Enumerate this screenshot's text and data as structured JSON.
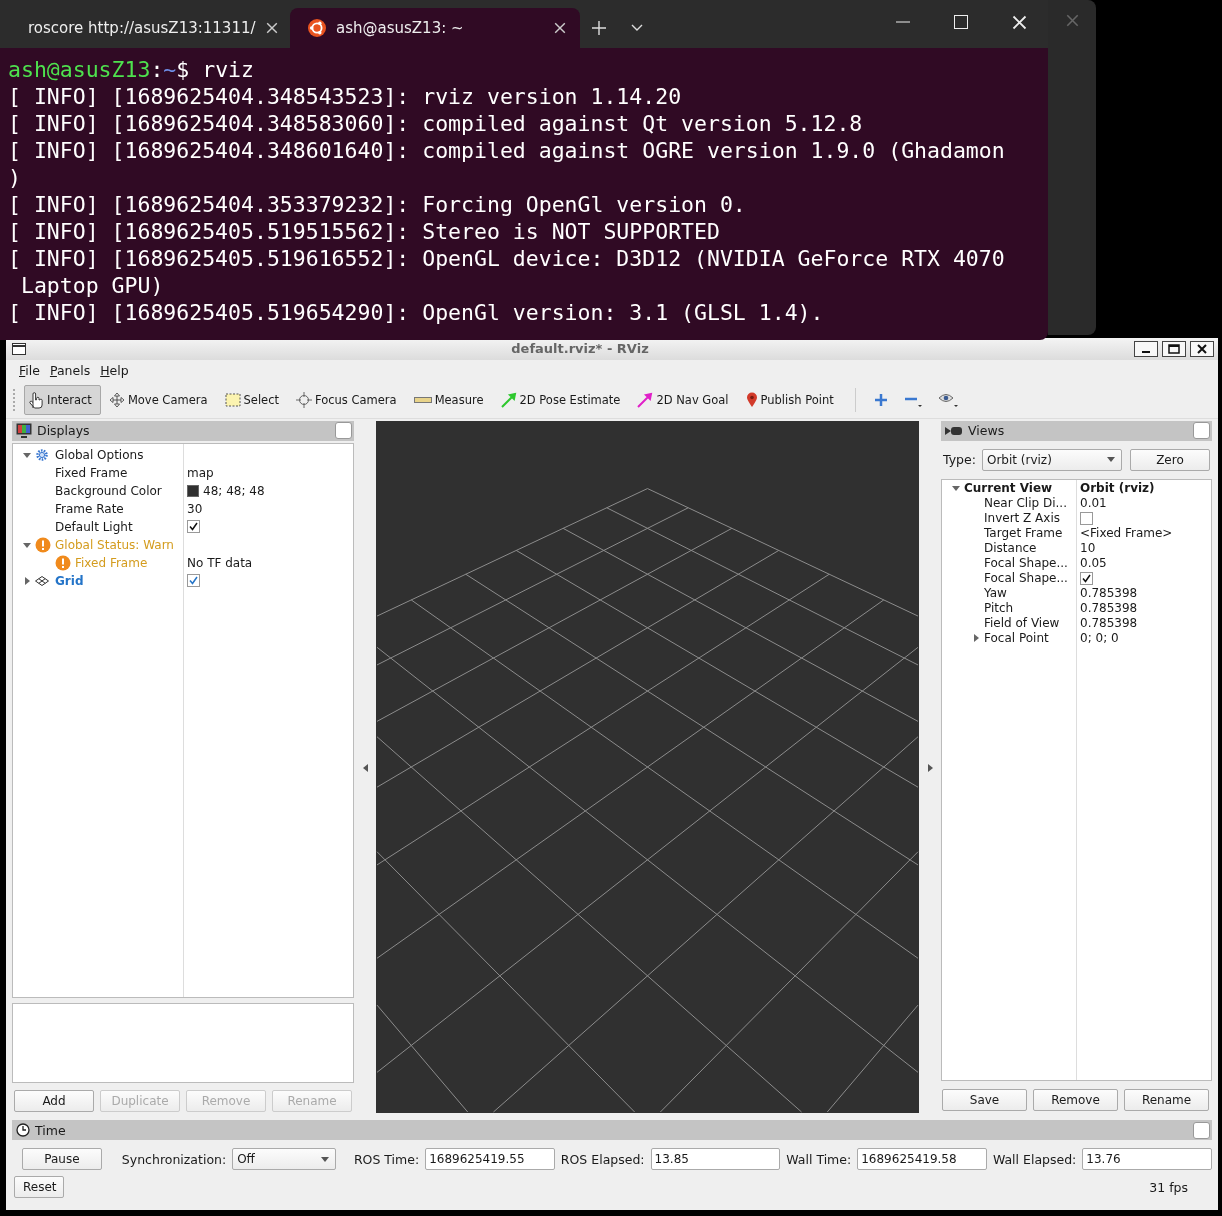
{
  "terminal": {
    "tabs": [
      {
        "title": "roscore http://asusZ13:11311/",
        "kind": "console",
        "selected": false
      },
      {
        "title": "ash@asusZ13: ~",
        "kind": "ubuntu",
        "selected": true
      }
    ],
    "prompt": {
      "user": "ash@asusZ13",
      "separator": ":",
      "path": "~",
      "symbol": "$",
      "command": "rviz"
    },
    "lines": [
      "[ INFO] [1689625404.348543523]: rviz version 1.14.20",
      "[ INFO] [1689625404.348583060]: compiled against Qt version 5.12.8",
      "[ INFO] [1689625404.348601640]: compiled against OGRE version 1.9.0 (Ghadamon",
      ")",
      "[ INFO] [1689625404.353379232]: Forcing OpenGl version 0.",
      "[ INFO] [1689625405.519515562]: Stereo is NOT SUPPORTED",
      "[ INFO] [1689625405.519616552]: OpenGL device: D3D12 (NVIDIA GeForce RTX 4070",
      " Laptop GPU)",
      "[ INFO] [1689625405.519654290]: OpenGl version: 3.1 (GLSL 1.4)."
    ]
  },
  "rviz": {
    "title": "default.rviz* - RViz",
    "menu": [
      "File",
      "Panels",
      "Help"
    ],
    "tools": [
      {
        "label": "Interact",
        "kind": "interact",
        "selected": true
      },
      {
        "label": "Move Camera",
        "kind": "move_camera",
        "selected": false
      },
      {
        "label": "Select",
        "kind": "select",
        "selected": false
      },
      {
        "label": "Focus Camera",
        "kind": "focus_camera",
        "selected": false
      },
      {
        "label": "Measure",
        "kind": "measure",
        "selected": false
      },
      {
        "label": "2D Pose Estimate",
        "kind": "pose_estimate",
        "selected": false
      },
      {
        "label": "2D Nav Goal",
        "kind": "nav_goal",
        "selected": false
      },
      {
        "label": "Publish Point",
        "kind": "publish_point",
        "selected": false
      }
    ],
    "displays": {
      "title": "Displays",
      "tree": [
        {
          "name": "Global Options",
          "kind": "options",
          "expanded": true,
          "children": [
            {
              "name": "Fixed Frame",
              "value": "map"
            },
            {
              "name": "Background Color",
              "value": "48; 48; 48",
              "color": "#303030"
            },
            {
              "name": "Frame Rate",
              "value": "30"
            },
            {
              "name": "Default Light",
              "checked": true
            }
          ]
        },
        {
          "name": "Global Status: Warn",
          "kind": "status",
          "expanded": true,
          "children": [
            {
              "name": "Fixed Frame",
              "kind": "status",
              "value": "No TF data"
            }
          ]
        },
        {
          "name": "Grid",
          "kind": "display",
          "checked": true,
          "expanded": false
        }
      ],
      "buttons": [
        {
          "label": "Add",
          "disabled": false
        },
        {
          "label": "Duplicate",
          "disabled": true
        },
        {
          "label": "Remove",
          "disabled": true
        },
        {
          "label": "Rename",
          "disabled": true
        }
      ]
    },
    "views": {
      "title": "Views",
      "type_label": "Type:",
      "type_value": "Orbit (rviz)",
      "zero": "Zero",
      "tree": [
        {
          "name": "Current View",
          "kind": "category",
          "value": "Orbit (rviz)",
          "expanded": true,
          "children": [
            {
              "name": "Near Clip Di...",
              "value": "0.01"
            },
            {
              "name": "Invert Z Axis",
              "checked": false
            },
            {
              "name": "Target Frame",
              "value": "<Fixed Frame>"
            },
            {
              "name": "Distance",
              "value": "10"
            },
            {
              "name": "Focal Shape...",
              "value": "0.05"
            },
            {
              "name": "Focal Shape...",
              "checked": true
            },
            {
              "name": "Yaw",
              "value": "0.785398"
            },
            {
              "name": "Pitch",
              "value": "0.785398"
            },
            {
              "name": "Field of View",
              "value": "0.785398"
            },
            {
              "name": "Focal Point",
              "value": "0; 0; 0",
              "expanded": false
            }
          ]
        }
      ],
      "buttons": [
        "Save",
        "Remove",
        "Rename"
      ]
    },
    "time": {
      "title": "Time",
      "pause": "Pause",
      "sync_label": "Synchronization:",
      "sync_value": "Off",
      "fields": [
        {
          "label": "ROS Time:",
          "value": "1689625419.55"
        },
        {
          "label": "ROS Elapsed:",
          "value": "13.85"
        },
        {
          "label": "Wall Time:",
          "value": "1689625419.58"
        },
        {
          "label": "Wall Elapsed:",
          "value": "13.76"
        }
      ],
      "reset": "Reset",
      "fps": "31 fps"
    }
  }
}
